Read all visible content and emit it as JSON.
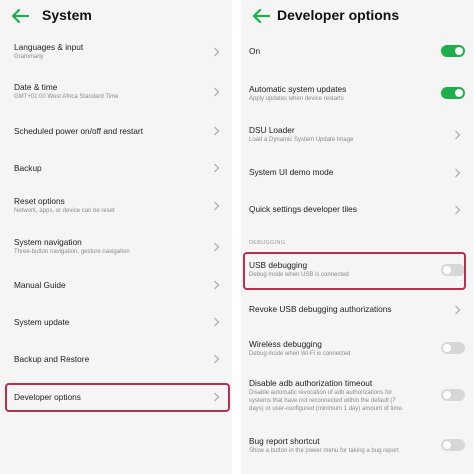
{
  "left": {
    "title": "System",
    "items": [
      {
        "label": "Languages & input",
        "sub": "Grammarly"
      },
      {
        "label": "Date & time",
        "sub": "GMT+01:00 West Africa Standard Time"
      },
      {
        "label": "Scheduled power on/off and restart",
        "sub": ""
      },
      {
        "label": "Backup",
        "sub": ""
      },
      {
        "label": "Reset options",
        "sub": "Network, apps, or device can be reset"
      },
      {
        "label": "System navigation",
        "sub": "Three-button navigation, gesture navigation"
      },
      {
        "label": "Manual Guide",
        "sub": ""
      },
      {
        "label": "System update",
        "sub": ""
      },
      {
        "label": "Backup and Restore",
        "sub": ""
      },
      {
        "label": "Developer options",
        "sub": ""
      }
    ]
  },
  "right": {
    "title": "Developer options",
    "section_debugging": "DEBUGGING",
    "items": [
      {
        "label": "On",
        "sub": "",
        "control": "toggle",
        "state": "on"
      },
      {
        "label": "Automatic system updates",
        "sub": "Apply updates when device restarts",
        "control": "toggle",
        "state": "on"
      },
      {
        "label": "DSU Loader",
        "sub": "Load a Dynamic System Update Image",
        "control": "chevron"
      },
      {
        "label": "System UI demo mode",
        "sub": "",
        "control": "chevron"
      },
      {
        "label": "Quick settings developer tiles",
        "sub": "",
        "control": "chevron"
      },
      {
        "label": "USB debugging",
        "sub": "Debug mode when USB is connected",
        "control": "toggle",
        "state": "off"
      },
      {
        "label": "Revoke USB debugging authorizations",
        "sub": "",
        "control": "chevron"
      },
      {
        "label": "Wireless debugging",
        "sub": "Debug mode when Wi-Fi is connected",
        "control": "toggle",
        "state": "off"
      },
      {
        "label": "Disable adb authorization timeout",
        "sub": [
          "Disable automatic revocation of adb authorizations for",
          "systems that have not reconnected within the default (7",
          "days) or user-configured (minimum 1 day) amount of time."
        ],
        "control": "toggle",
        "state": "off"
      },
      {
        "label": "Bug report shortcut",
        "sub": "Show a button in the power menu for taking a bug report",
        "control": "toggle",
        "state": "off"
      }
    ]
  },
  "colors": {
    "accent": "#1bb04a",
    "highlight": "#b9304d",
    "panel_bg": "#f5f5f5"
  }
}
